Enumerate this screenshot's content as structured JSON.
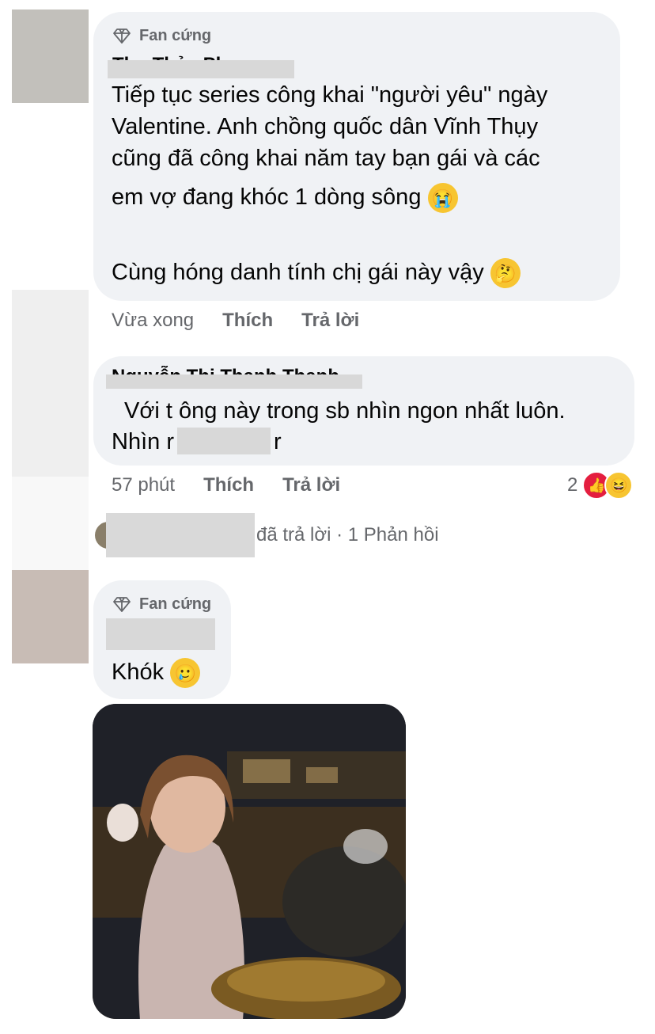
{
  "comments": [
    {
      "badge": "Fan cứng",
      "author": "Thu Thảo Phan",
      "lines": [
        "Tiếp tục series công khai \"người yêu\" ngày",
        "Valentine. Anh chồng quốc dân Vĩnh Thụy",
        "cũng đã công khai năm tay bạn gái và các",
        "em vợ đang khóc 1 dòng sông"
      ],
      "line2": "Cùng hóng danh tính chị gái này vậy",
      "time": "Vừa xong",
      "like": "Thích",
      "reply": "Trả lời"
    },
    {
      "author": "Nguyễn Thị Thanh Thanh",
      "line1": "Với t ông này trong sb nhìn ngon nhất luôn.",
      "line2": "Nhìn r",
      "line2_end": "r",
      "time": "57 phút",
      "like": "Thích",
      "reply": "Trả lời",
      "reaction_count": "2"
    },
    {
      "badge": "Fan cứng",
      "text": "Khók",
      "image_alt": "crying woman at dinner table"
    }
  ],
  "reply_summary": "đã trả lời · 1 Phản hồi",
  "icons": {
    "badge": "diamond-icon",
    "like": "like-reaction-icon",
    "haha": "haha-reaction-icon"
  },
  "colors": {
    "bubble": "#f0f2f5",
    "meta": "#65676b",
    "like_red": "#e41e3f"
  }
}
